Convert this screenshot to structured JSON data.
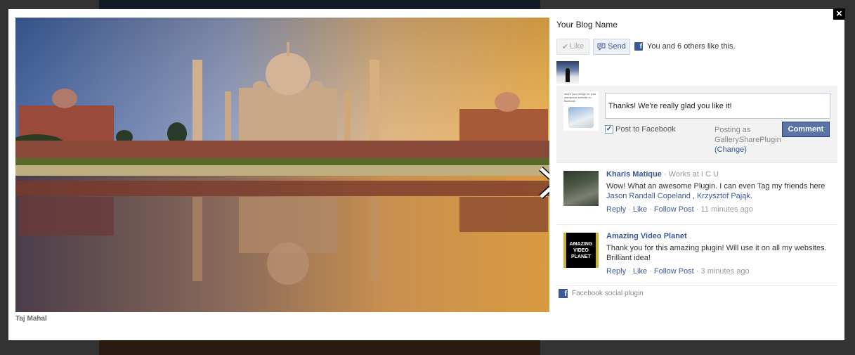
{
  "photo": {
    "caption": "Taj Mahal",
    "next_icon": "chevron-right-icon"
  },
  "close_icon": "×",
  "sidebar": {
    "blog_name": "Your Blog Name",
    "like_button": "Like",
    "like_icon": "✔",
    "send_button": "Send",
    "send_icon": "speech-bubble-icon",
    "fb_icon": "f",
    "like_summary": "You and 6 others like this.",
    "compose": {
      "avatar_text": "share your image on your wordpress website on facebook",
      "comment_value": "Thanks! We're really glad you like it!",
      "post_to_facebook_label": "Post to Facebook",
      "post_to_facebook_checked": true,
      "posting_as_label": "Posting as",
      "posting_as_name": "GallerySharePlugin",
      "change_link": "(Change)",
      "comment_button": "Comment"
    },
    "comments": [
      {
        "author": "Kharis Matique",
        "meta": " · Works at I C U",
        "text": "Wow! What an awesome Plugin. I can even Tag my friends here ",
        "tag1": "Jason Randall Copeland",
        "sep": " , ",
        "tag2": "Krzysztof Pająk",
        "end": ".",
        "reply": "Reply",
        "like": "Like",
        "follow": "Follow Post",
        "time": "11 minutes ago"
      },
      {
        "author": "Amazing Video Planet",
        "avatar_text": "AMAZING VIDEO PLANET",
        "text": "Thank you for this amazing plugin! Will use it on all my websites. Brilliant idea!",
        "reply": "Reply",
        "like": "Like",
        "follow": "Follow Post",
        "time": "3 minutes ago"
      }
    ],
    "dot": " · ",
    "footer": "Facebook social plugin"
  }
}
